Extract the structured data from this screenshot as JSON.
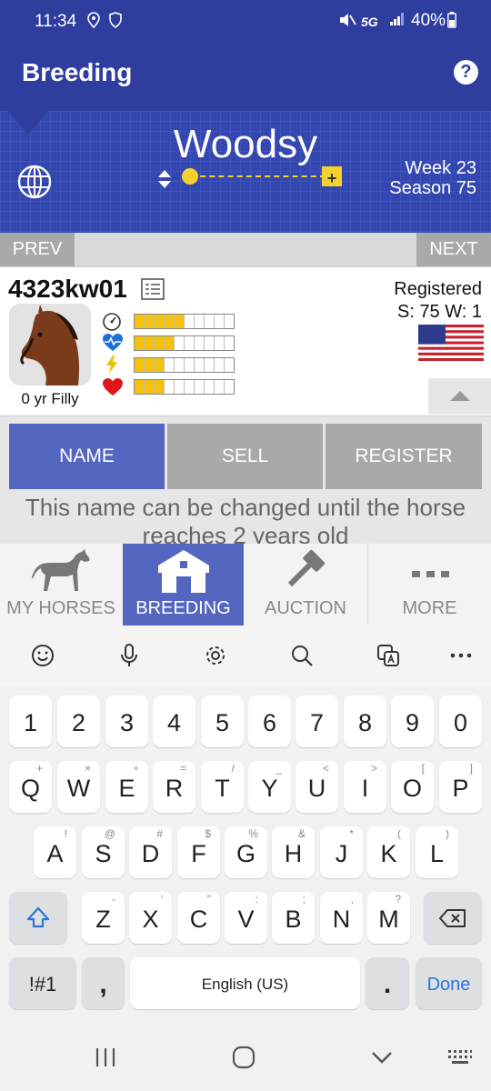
{
  "status_bar": {
    "time": "11:34",
    "signal_label": "5G",
    "battery": "40%"
  },
  "app_bar": {
    "title": "Breeding",
    "help_icon": "?"
  },
  "banner": {
    "stable_name": "Woodsy",
    "week": "Week 23",
    "season": "Season 75",
    "slider_plus": "+"
  },
  "nav": {
    "prev": "PREV",
    "next": "NEXT"
  },
  "horse": {
    "name": "4323kw01",
    "age_sex": "0 yr Filly",
    "registration": "Registered",
    "record": "S: 75 W: 1",
    "stats": [
      {
        "icon": "speedometer-icon",
        "filled": 5,
        "total": 10
      },
      {
        "icon": "heart-monitor-icon",
        "filled": 4,
        "total": 10
      },
      {
        "icon": "lightning-icon",
        "filled": 3,
        "total": 10
      },
      {
        "icon": "heart-icon",
        "filled": 3,
        "total": 10
      }
    ]
  },
  "actions": {
    "name": "NAME",
    "sell": "SELL",
    "register": "REGISTER"
  },
  "hint_text": "This name can be changed until the horse reaches 2 years old",
  "tabs": {
    "my_horses": "MY HORSES",
    "breeding": "BREEDING",
    "auction": "AUCTION",
    "more": "MORE"
  },
  "keyboard": {
    "numbers": [
      "1",
      "2",
      "3",
      "4",
      "5",
      "6",
      "7",
      "8",
      "9",
      "0"
    ],
    "row1": [
      "Q",
      "W",
      "E",
      "R",
      "T",
      "Y",
      "U",
      "I",
      "O",
      "P"
    ],
    "row1_sup": [
      "+",
      "×",
      "÷",
      "=",
      "/",
      "_",
      "<",
      ">",
      "[",
      "]"
    ],
    "row2": [
      "A",
      "S",
      "D",
      "F",
      "G",
      "H",
      "J",
      "K",
      "L"
    ],
    "row2_sup": [
      "!",
      "@",
      "#",
      "$",
      "%",
      "&",
      "*",
      "(",
      ")"
    ],
    "row3": [
      "Z",
      "X",
      "C",
      "V",
      "B",
      "N",
      "M"
    ],
    "row3_sup": [
      "-",
      "'",
      "\"",
      ":",
      ";",
      ",",
      "?"
    ],
    "symbols": "!#1",
    "comma": ",",
    "space": "English (US)",
    "period": ".",
    "done": "Done"
  },
  "colors": {
    "primary": "#2f3d9f",
    "active_tab": "#5566c1",
    "bar_fill": "#f4c20d",
    "accent_blue": "#2a77d6"
  }
}
